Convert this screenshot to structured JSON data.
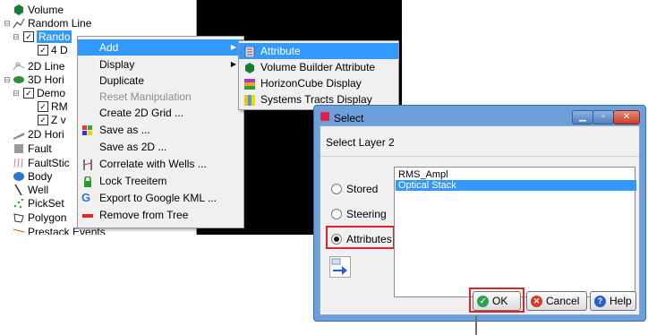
{
  "tree": {
    "items": [
      {
        "label": "Volume"
      },
      {
        "label": "Random Line"
      },
      {
        "label": "Rando"
      },
      {
        "label": "4 D"
      },
      {
        "label": "2D Line"
      },
      {
        "label": "3D Hori"
      },
      {
        "label": "Demo"
      },
      {
        "label": "RM"
      },
      {
        "label": "Z v"
      },
      {
        "label": "2D Hori"
      },
      {
        "label": "Fault"
      },
      {
        "label": "FaultStic"
      },
      {
        "label": "Body"
      },
      {
        "label": "Well"
      },
      {
        "label": "PickSet"
      },
      {
        "label": "Polygon"
      },
      {
        "label": "Prestack Events"
      }
    ]
  },
  "context_menu": {
    "items": [
      {
        "label": "Add",
        "icon": "none",
        "submenu": true
      },
      {
        "label": "Display",
        "icon": "none",
        "submenu": true
      },
      {
        "label": "Duplicate",
        "icon": "none"
      },
      {
        "label": "Reset Manipulation",
        "icon": "none",
        "disabled": true
      },
      {
        "label": "Create 2D Grid ...",
        "icon": "none"
      },
      {
        "label": "Save as ...",
        "icon": "save-icon"
      },
      {
        "label": "Save as 2D ...",
        "icon": "none"
      },
      {
        "label": "Correlate with Wells ...",
        "icon": "well-correlate-icon"
      },
      {
        "label": "Lock Treeitem",
        "icon": "lock-icon"
      },
      {
        "label": "Export to Google KML ...",
        "icon": "google-icon"
      },
      {
        "label": "Remove from Tree",
        "icon": "remove-icon"
      }
    ]
  },
  "submenu": {
    "items": [
      {
        "label": "Attribute",
        "icon": "attribute-icon"
      },
      {
        "label": "Volume Builder Attribute",
        "icon": "volume-builder-icon"
      },
      {
        "label": "HorizonCube Display",
        "icon": "horizoncube-icon"
      },
      {
        "label": "Systems Tracts Display",
        "icon": "systems-tracts-icon"
      }
    ]
  },
  "dialog": {
    "title": "Select",
    "subtitle": "Select Layer 2",
    "radios": [
      {
        "label": "Stored",
        "checked": false
      },
      {
        "label": "Steering",
        "checked": false
      },
      {
        "label": "Attributes",
        "checked": true
      }
    ],
    "list": [
      {
        "label": "RMS_Ampl",
        "selected": false
      },
      {
        "label": "Optical Stack",
        "selected": true
      }
    ],
    "buttons": {
      "ok": "OK",
      "cancel": "Cancel",
      "help": "Help"
    },
    "highlight_color": "#e4202a"
  },
  "colors": {
    "selection": "#3399ff",
    "dialog_frame": "#6da0da"
  }
}
